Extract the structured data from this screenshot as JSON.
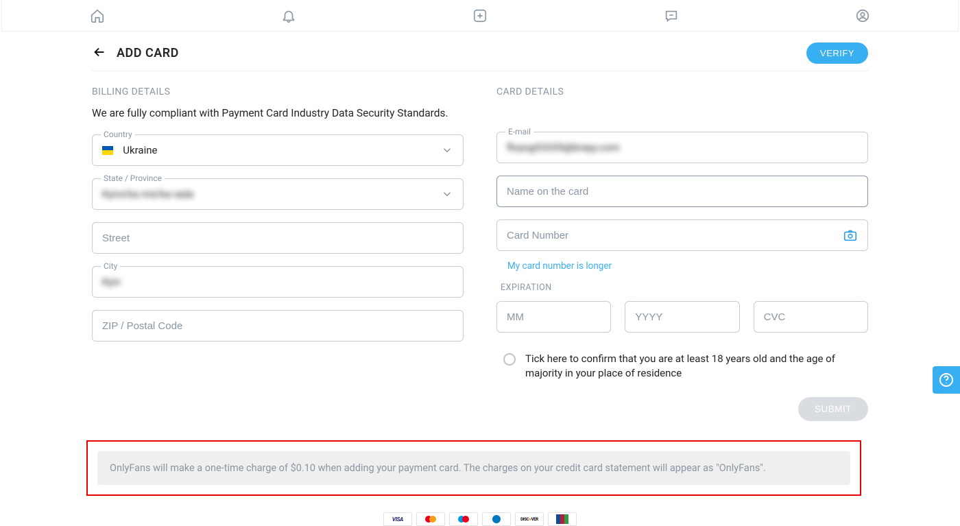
{
  "page": {
    "title": "ADD CARD",
    "verify_label": "VERIFY"
  },
  "billing": {
    "section_label": "BILLING DETAILS",
    "compliance_text": "We are fully compliant with Payment Card Industry Data Security Standards.",
    "country_label": "Country",
    "country_value": "Ukraine",
    "state_label": "State / Province",
    "state_value": "Kyivs'ka mis'ka rada",
    "street_placeholder": "Street",
    "city_label": "City",
    "city_value": "Kyiv",
    "zip_placeholder": "ZIP / Postal Code"
  },
  "card": {
    "section_label": "CARD DETAILS",
    "email_label": "E-mail",
    "email_value": "floyog53205@brayy.com",
    "name_placeholder": "Name on the card",
    "number_placeholder": "Card Number",
    "longer_link": "My card number is longer",
    "expiration_label": "EXPIRATION",
    "mm_placeholder": "MM",
    "yyyy_placeholder": "YYYY",
    "cvc_placeholder": "CVC",
    "confirm_text": "Tick here to confirm that you are at least 18 years old and the age of majority in your place of residence",
    "submit_label": "SUBMIT"
  },
  "notice": {
    "text": "OnlyFans will make a one-time charge of $0.10 when adding your payment card. The charges on your credit card statement will appear as \"OnlyFans\"."
  },
  "card_brands": [
    "VISA",
    "MasterCard",
    "Maestro",
    "Diners",
    "DISCOVER",
    "JCB"
  ]
}
